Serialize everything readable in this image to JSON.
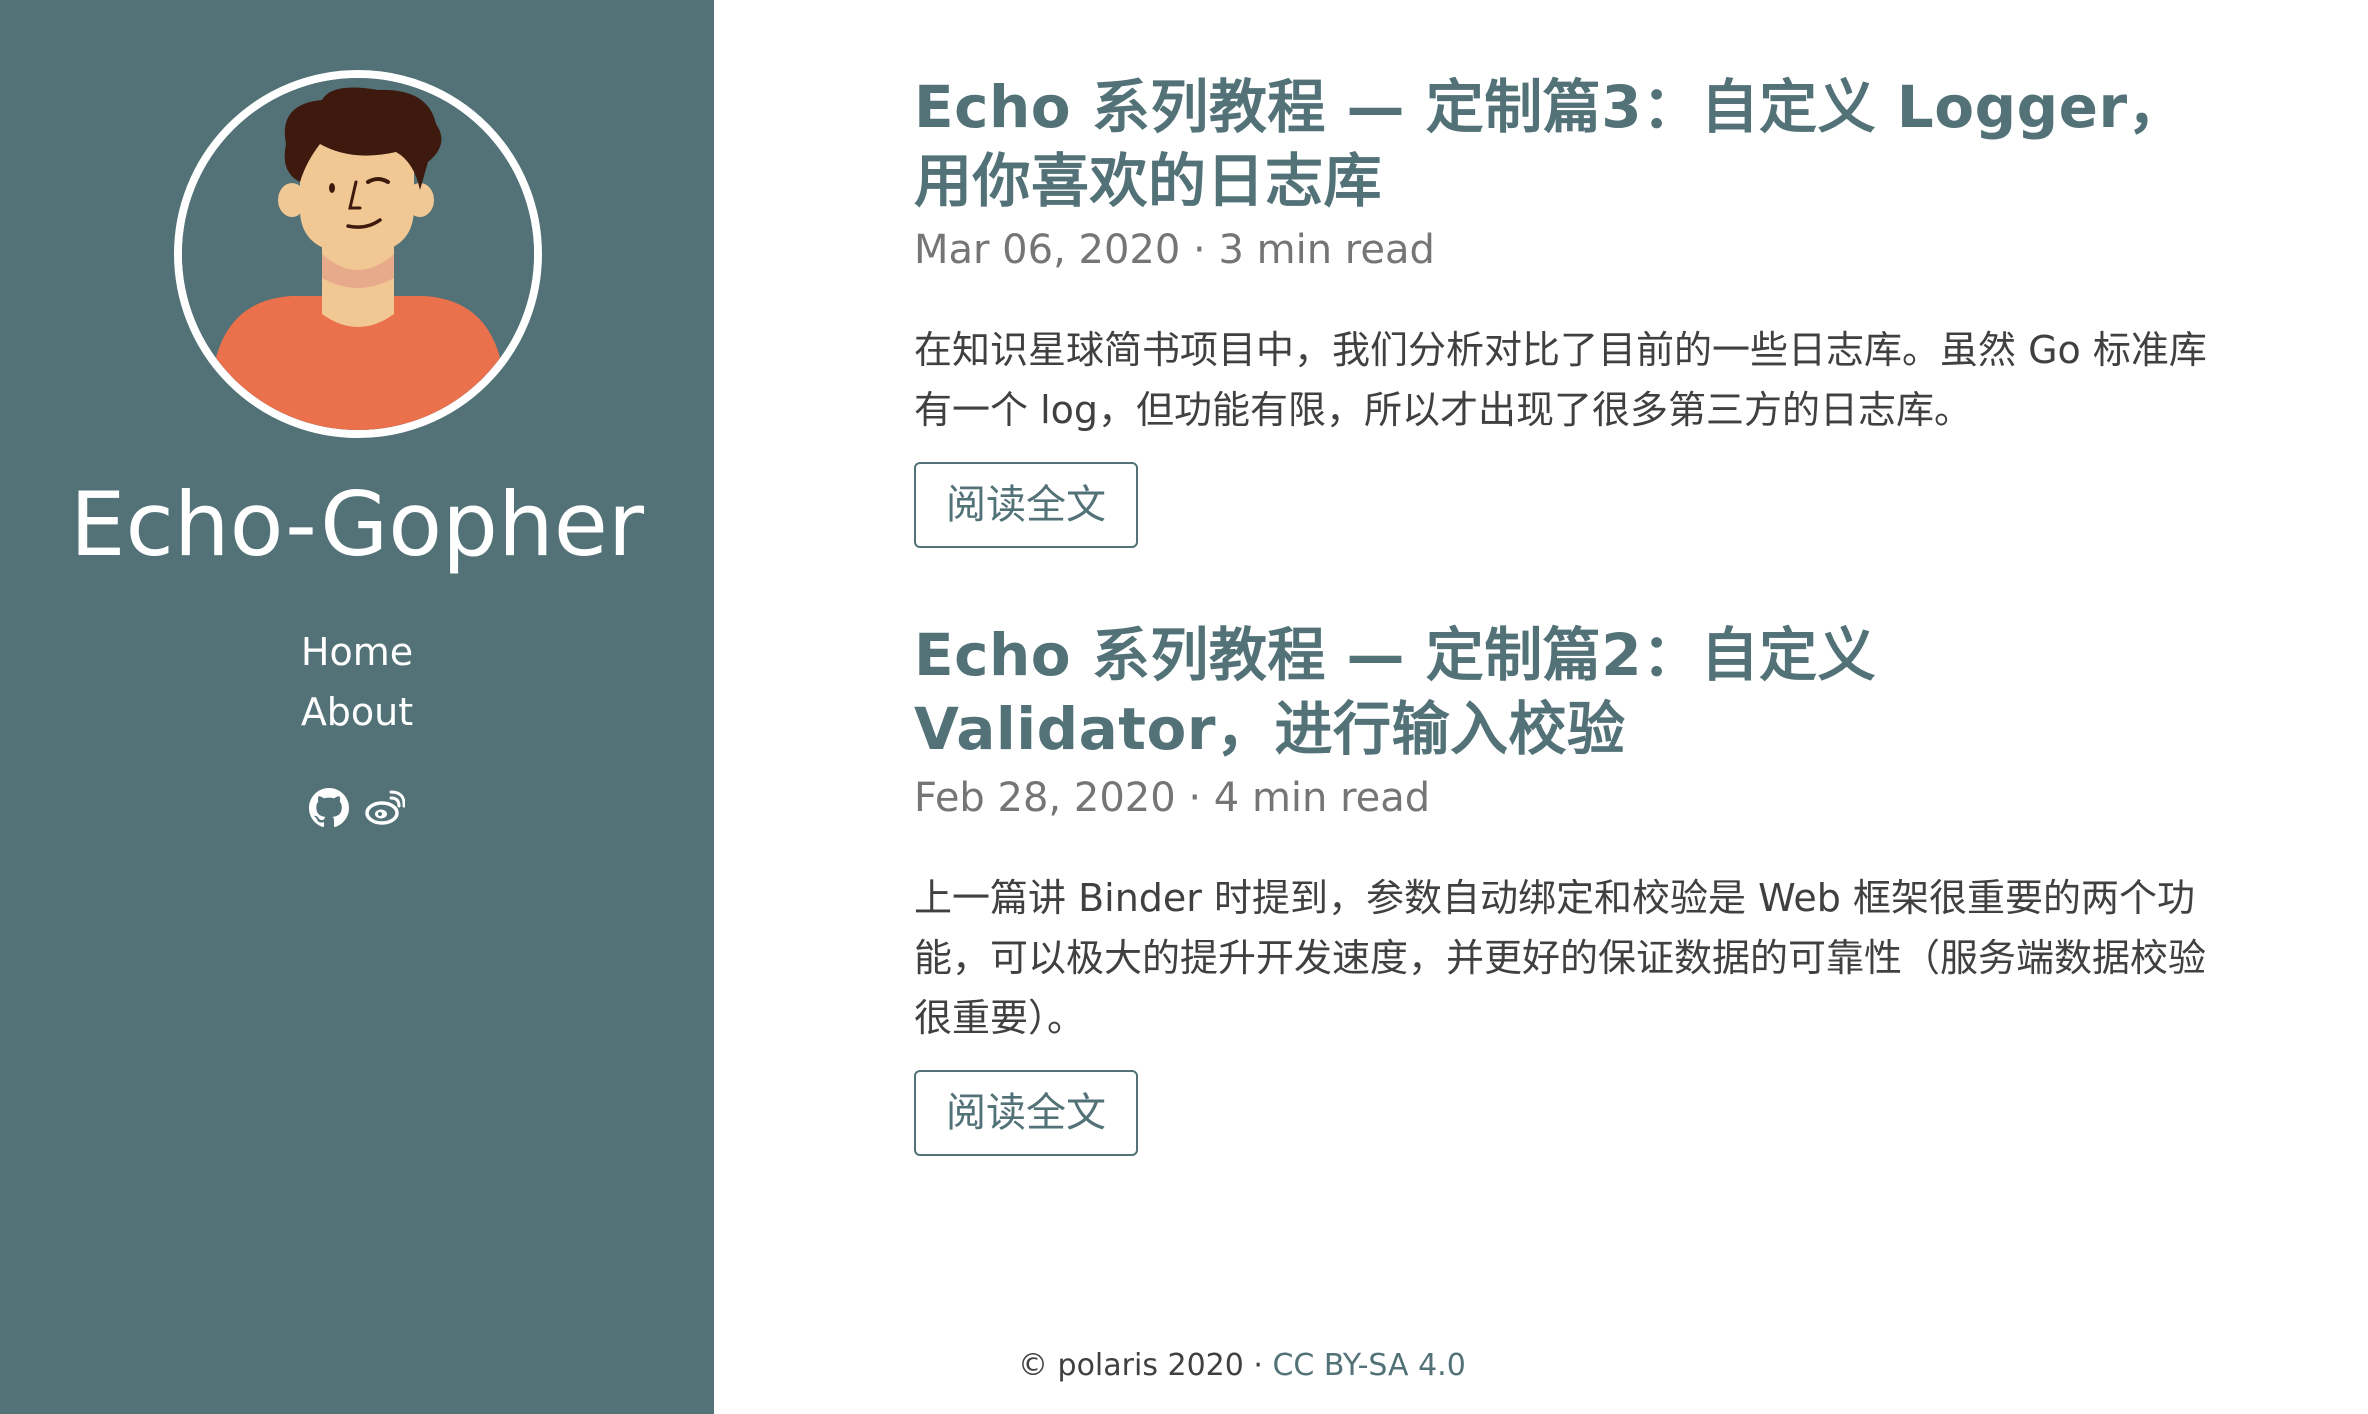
{
  "site": {
    "title": "Echo-Gopher"
  },
  "nav": {
    "items": [
      {
        "label": "Home"
      },
      {
        "label": "About"
      }
    ]
  },
  "social": {
    "icons": [
      "github-icon",
      "weibo-icon"
    ]
  },
  "posts": [
    {
      "title": "Echo 系列教程 — 定制篇3：自定义 Logger，用你喜欢的日志库",
      "meta": "Mar 06, 2020 · 3 min read",
      "excerpt": "在知识星球简书项目中，我们分析对比了目前的一些日志库。虽然 Go 标准库有一个 log，但功能有限，所以才出现了很多第三方的日志库。",
      "button_label": "阅读全文"
    },
    {
      "title": "Echo 系列教程 — 定制篇2：自定义 Validator，进行输入校验",
      "meta": "Feb 28, 2020 · 4 min read",
      "excerpt": "上一篇讲 Binder 时提到，参数自动绑定和校验是 Web 框架很重要的两个功能，可以极大的提升开发速度，并更好的保证数据的可靠性（服务端数据校验很重要）。",
      "button_label": "阅读全文"
    }
  ],
  "footer": {
    "copyright": "© polaris 2020 · ",
    "license_link": "CC BY-SA 4.0"
  },
  "colors": {
    "sidebar_bg": "#527278",
    "accent": "#527278",
    "text": "#404040",
    "meta": "#757575"
  }
}
